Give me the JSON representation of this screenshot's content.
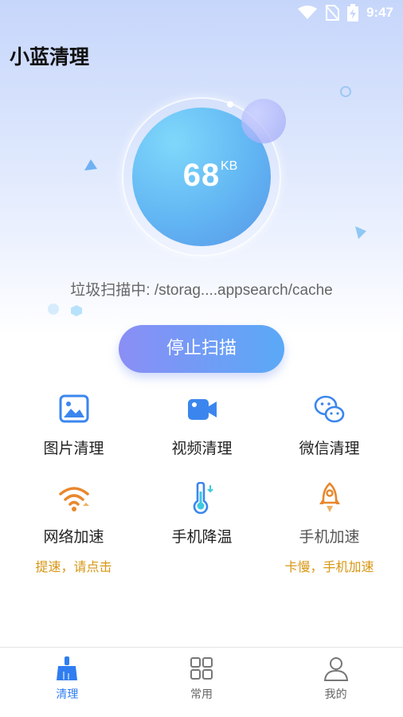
{
  "status_bar": {
    "time": "9:47"
  },
  "app_title": "小蓝清理",
  "gauge": {
    "value": "68",
    "unit": "KB"
  },
  "scan_status": "垃圾扫描中: /storag....appsearch/cache",
  "stop_button_label": "停止扫描",
  "features": [
    {
      "label": "图片清理",
      "icon": "image-icon"
    },
    {
      "label": "视频清理",
      "icon": "video-camera-icon"
    },
    {
      "label": "微信清理",
      "icon": "wechat-icon"
    },
    {
      "label": "网络加速",
      "sub": "提速，请点击",
      "icon": "wifi-icon"
    },
    {
      "label": "手机降温",
      "icon": "thermometer-icon"
    },
    {
      "label": "手机加速",
      "sub": "卡慢，手机加速",
      "icon": "rocket-icon"
    }
  ],
  "bottom_nav": [
    {
      "label": "清理",
      "icon": "broom-icon",
      "active": true
    },
    {
      "label": "常用",
      "icon": "grid-icon",
      "active": false
    },
    {
      "label": "我的",
      "icon": "user-icon",
      "active": false
    }
  ],
  "colors": {
    "accent": "#2f7df0",
    "orange": "#e8872e",
    "subtext": "#d79614",
    "icon_blue": "#3b86ee"
  }
}
